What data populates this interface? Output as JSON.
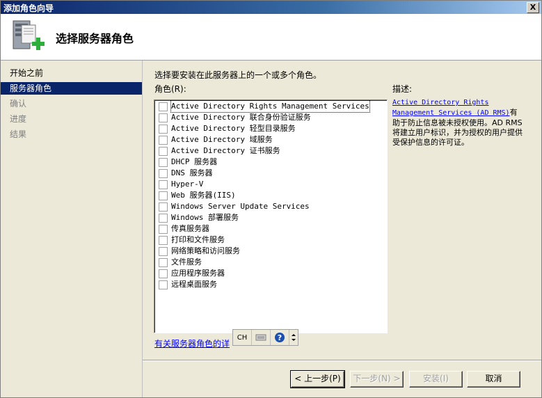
{
  "window": {
    "title": "添加角色向导",
    "close_glyph": "X"
  },
  "header": {
    "title": "选择服务器角色",
    "icon": "server-add-icon"
  },
  "nav": {
    "items": [
      {
        "label": "开始之前",
        "state": "normal"
      },
      {
        "label": "服务器角色",
        "state": "selected"
      },
      {
        "label": "确认",
        "state": "disabled"
      },
      {
        "label": "进度",
        "state": "disabled"
      },
      {
        "label": "结果",
        "state": "disabled"
      }
    ]
  },
  "main": {
    "instruction": "选择要安装在此服务器上的一个或多个角色。",
    "roles_label": "角色(R):",
    "roles": [
      {
        "label": "Active Directory Rights Management Services",
        "checked": false
      },
      {
        "label": "Active Directory 联合身份验证服务",
        "checked": false
      },
      {
        "label": "Active Directory 轻型目录服务",
        "checked": false
      },
      {
        "label": "Active Directory 域服务",
        "checked": false
      },
      {
        "label": "Active Directory 证书服务",
        "checked": false
      },
      {
        "label": "DHCP 服务器",
        "checked": false
      },
      {
        "label": "DNS 服务器",
        "checked": false
      },
      {
        "label": "Hyper-V",
        "checked": false
      },
      {
        "label": "Web 服务器(IIS)",
        "checked": false
      },
      {
        "label": "Windows Server Update Services",
        "checked": false
      },
      {
        "label": "Windows 部署服务",
        "checked": false
      },
      {
        "label": "传真服务器",
        "checked": false
      },
      {
        "label": "打印和文件服务",
        "checked": false
      },
      {
        "label": "网络策略和访问服务",
        "checked": false
      },
      {
        "label": "文件服务",
        "checked": false
      },
      {
        "label": "应用程序服务器",
        "checked": false
      },
      {
        "label": "远程桌面服务",
        "checked": false
      }
    ],
    "description_label": "描述:",
    "description_link": "Active Directory Rights Management Services (AD RMS)",
    "description_text": "有助于防止信息被未授权使用。AD RMS 将建立用户标识，并为授权的用户提供受保护信息的许可证。",
    "more_link": "有关服务器角色的详"
  },
  "ime": {
    "lang": "CH"
  },
  "footer": {
    "back": "< 上一步(P)",
    "next": "下一步(N) >",
    "install": "安装(I)",
    "cancel": "取消"
  }
}
